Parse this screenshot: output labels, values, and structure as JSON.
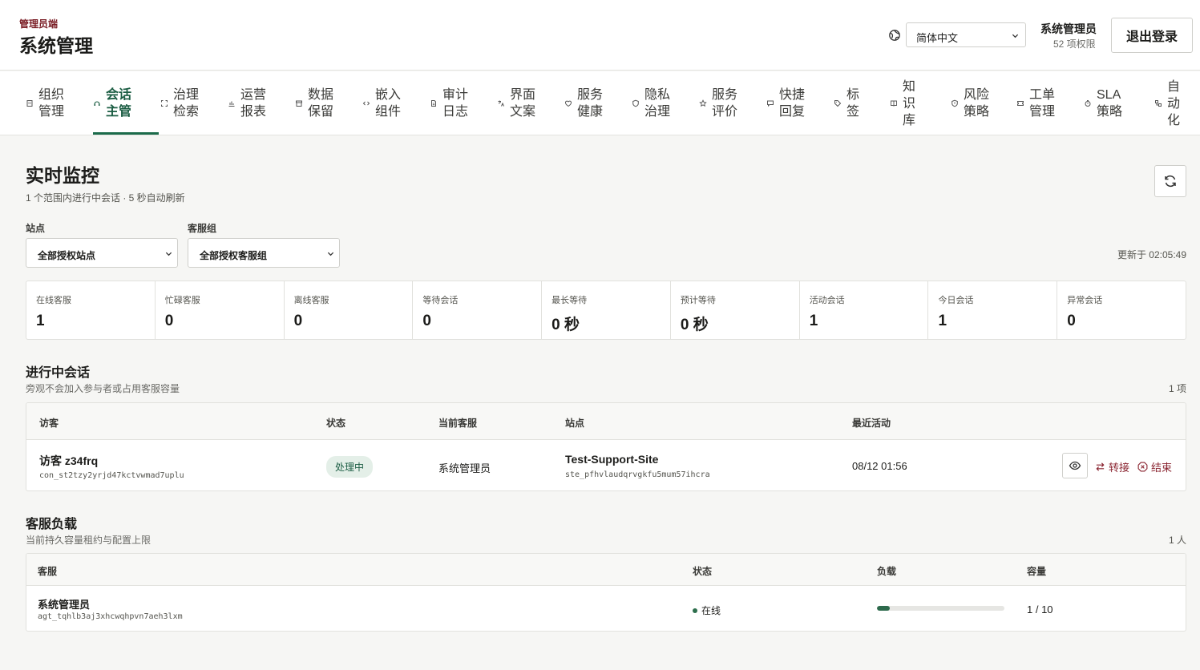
{
  "header": {
    "brand_sub": "管理员端",
    "brand_title": "系统管理",
    "language": "简体中文",
    "user_name": "系统管理员",
    "user_permissions": "52 项权限",
    "logout_label": "退出登录"
  },
  "nav": {
    "items": [
      {
        "label": "组织\n管理",
        "icon": "building-icon"
      },
      {
        "label": "会话\n主管",
        "icon": "headset-icon",
        "active": true
      },
      {
        "label": "治理\n检索",
        "icon": "scan-icon"
      },
      {
        "label": "运营\n报表",
        "icon": "bar-chart-icon"
      },
      {
        "label": "数据\n保留",
        "icon": "archive-icon"
      },
      {
        "label": "嵌入\n组件",
        "icon": "code-icon"
      },
      {
        "label": "审计\n日志",
        "icon": "file-text-icon"
      },
      {
        "label": "界面\n文案",
        "icon": "languages-icon"
      },
      {
        "label": "服务\n健康",
        "icon": "heart-pulse-icon"
      },
      {
        "label": "隐私\n治理",
        "icon": "shield-icon"
      },
      {
        "label": "服务\n评价",
        "icon": "star-icon"
      },
      {
        "label": "快捷\n回复",
        "icon": "message-icon"
      },
      {
        "label": "标\n签",
        "icon": "tag-icon"
      },
      {
        "label": "知\n识\n库",
        "icon": "book-icon"
      },
      {
        "label": "风险\n策略",
        "icon": "alert-shield-icon"
      },
      {
        "label": "工单\n管理",
        "icon": "ticket-icon"
      },
      {
        "label": "SLA\n策略",
        "icon": "timer-icon"
      },
      {
        "label": "自\n动\n化",
        "icon": "workflow-icon"
      }
    ]
  },
  "monitor": {
    "title": "实时监控",
    "subtitle": "1 个范围内进行中会话 · 5 秒自动刷新",
    "refresh_icon": "refresh-icon",
    "filters": {
      "site_label": "站点",
      "site_value": "全部授权站点",
      "group_label": "客服组",
      "group_value": "全部授权客服组"
    },
    "updated": "更新于 02:05:49"
  },
  "stats": [
    {
      "label": "在线客服",
      "value": "1"
    },
    {
      "label": "忙碌客服",
      "value": "0"
    },
    {
      "label": "离线客服",
      "value": "0"
    },
    {
      "label": "等待会话",
      "value": "0"
    },
    {
      "label": "最长等待",
      "value": "0 秒"
    },
    {
      "label": "预计等待",
      "value": "0 秒"
    },
    {
      "label": "活动会话",
      "value": "1"
    },
    {
      "label": "今日会话",
      "value": "1"
    },
    {
      "label": "异常会话",
      "value": "0"
    }
  ],
  "sessions": {
    "title": "进行中会话",
    "subtitle": "旁观不会加入参与者或占用客服容量",
    "count": "1 项",
    "columns": [
      "访客",
      "状态",
      "当前客服",
      "站点",
      "最近活动"
    ],
    "rows": [
      {
        "visitor": "访客 z34frq",
        "visitor_id": "con_st2tzy2yrjd47kctvwmad7uplu",
        "status": "处理中",
        "agent": "系统管理员",
        "site": "Test-Support-Site",
        "site_id": "ste_pfhvlaudqrvgkfu5mum57ihcra",
        "last_activity": "08/12 01:56",
        "transfer_label": "转接",
        "end_label": "结束"
      }
    ]
  },
  "load": {
    "title": "客服负载",
    "subtitle": "当前持久容量租约与配置上限",
    "count": "1 人",
    "columns": [
      "客服",
      "状态",
      "负载",
      "容量"
    ],
    "rows": [
      {
        "agent": "系统管理员",
        "agent_id": "agt_tqhlb3aj3xhcwqhpvn7aeh3lxm",
        "status": "在线",
        "load_fraction": 0.1,
        "capacity": "1 / 10"
      }
    ]
  },
  "colors": {
    "accent": "#1b6b4a",
    "danger": "#8a2430",
    "brand_sub": "#7a1d25"
  }
}
